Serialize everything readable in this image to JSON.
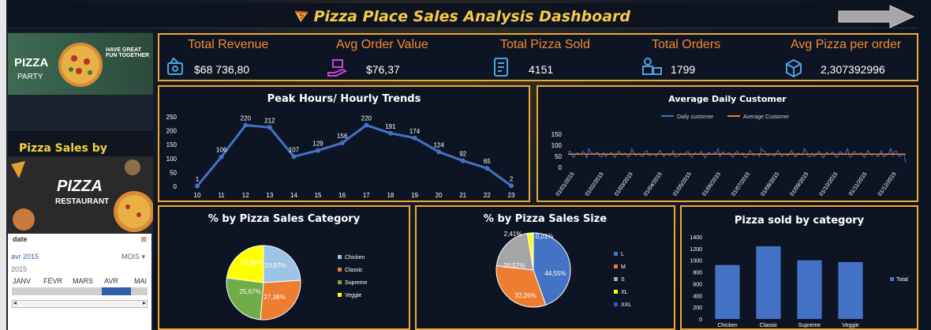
{
  "title": "Pizza Place Sales Analysis Dashboard",
  "sidebar": {
    "promo1_title": "PIZZA",
    "promo1_sub": "PARTY",
    "promo1_tag": "HAVE GREAT FUN TOGETHER",
    "heading": "Pizza Sales by Hours, Category and Size",
    "promo2_title": "PIZZA",
    "promo2_sub": "RESTAURANT"
  },
  "slicer": {
    "field": "date",
    "selected": "avr 2015",
    "period": "MOIS",
    "year": "2015",
    "months": [
      "JANV",
      "FÉVR",
      "MARS",
      "AVR",
      "MAI"
    ]
  },
  "kpis": [
    {
      "label": "Total Revenue",
      "value": "$68 736,80",
      "icon": "money-icon"
    },
    {
      "label": "Avg Order Value",
      "value": "$76,37",
      "icon": "hand-coin-icon"
    },
    {
      "label": "Total Pizza Sold",
      "value": "4151",
      "icon": "receipt-icon"
    },
    {
      "label": "Total Orders",
      "value": "1799",
      "icon": "delivery-icon"
    },
    {
      "label": "Avg Pizza per order",
      "value": "2,307392996",
      "icon": "box-icon"
    }
  ],
  "colors": {
    "accent": "#f0a830",
    "line": "#4472c4",
    "orange": "#ed7d31",
    "gray": "#a5a5a5",
    "yellow": "#ffff00",
    "green": "#70ad47",
    "lightblue": "#9dc3e6"
  },
  "chart_data": [
    {
      "type": "line",
      "title": "Peak Hours/ Hourly Trends",
      "x": [
        10,
        11,
        12,
        13,
        14,
        15,
        16,
        17,
        18,
        19,
        20,
        21,
        22,
        23
      ],
      "values": [
        1,
        106,
        220,
        212,
        107,
        129,
        156,
        220,
        191,
        174,
        124,
        92,
        65,
        2
      ],
      "ylim": [
        0,
        250
      ],
      "yticks": [
        0,
        50,
        100,
        150,
        200,
        250
      ]
    },
    {
      "type": "line",
      "title": "Average Daily Customer",
      "series": [
        {
          "name": "Daily customer"
        },
        {
          "name": "Average Customer"
        }
      ],
      "x_labels": [
        "01/01/2015",
        "01/02/2015",
        "01/03/2015",
        "01/04/2015",
        "01/05/2015",
        "01/06/2015",
        "01/07/2015",
        "01/08/2015",
        "01/09/2015",
        "01/10/2015",
        "01/11/2015",
        "01/12/2015"
      ],
      "ylim": [
        0,
        150
      ],
      "yticks": [
        0,
        50,
        100,
        150
      ],
      "average": 60
    },
    {
      "type": "pie",
      "title": "% by Pizza Sales Category",
      "labels": [
        "Chicken",
        "Classic",
        "Supreme",
        "Veggie"
      ],
      "values": [
        23.97,
        27.38,
        25.67,
        22.98
      ],
      "value_labels": [
        "23,97%",
        "27,38%",
        "25,67%",
        "22,98%"
      ]
    },
    {
      "type": "pie",
      "title": "% by Pizza Sales Size",
      "labels": [
        "L",
        "M",
        "S",
        "XL",
        "XXL"
      ],
      "values": [
        44.55,
        32.26,
        20.57,
        2.41,
        0.21
      ],
      "value_labels": [
        "44,55%",
        "32,26%",
        "20,57%",
        "2,41%",
        "0,21%"
      ]
    },
    {
      "type": "bar",
      "title": "Pizza sold by category",
      "categories": [
        "Chicken",
        "Classic",
        "Supreme",
        "Veggie"
      ],
      "values": [
        920,
        1240,
        1000,
        970
      ],
      "ylim": [
        0,
        1400
      ],
      "yticks": [
        0,
        200,
        400,
        600,
        800,
        1000,
        1200,
        1400
      ],
      "legend": "Total"
    }
  ]
}
